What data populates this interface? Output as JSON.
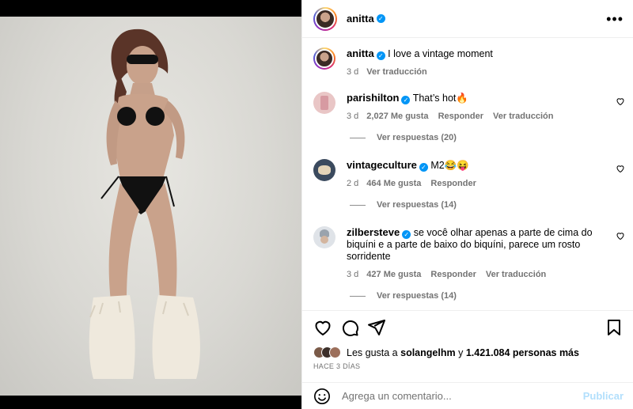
{
  "post": {
    "author": "anitta",
    "caption": "I love a vintage moment",
    "time": "3 d",
    "translate": "Ver traducción"
  },
  "comments": [
    {
      "user": "parishilton",
      "text": "That’s hot🔥",
      "time": "3 d",
      "likes": "2,027 Me gusta",
      "reply": "Responder",
      "translate": "Ver traducción",
      "replies": "Ver respuestas (20)"
    },
    {
      "user": "vintageculture",
      "text": "M2😂😝",
      "time": "2 d",
      "likes": "464 Me gusta",
      "reply": "Responder",
      "replies": "Ver respuestas (14)"
    },
    {
      "user": "zilbersteve",
      "text": "se você olhar apenas a parte de cima do biquíni e a parte de baixo do biquíni, parece um rosto sorridente",
      "time": "3 d",
      "likes": "427 Me gusta",
      "reply": "Responder",
      "translate": "Ver traducción",
      "replies": "Ver respuestas (14)"
    }
  ],
  "likes": {
    "prefix": "Les gusta a",
    "user": "solangelhm",
    "joiner": "y",
    "others": "1.421.084 personas más"
  },
  "ago": "HACE 3 DÍAS",
  "composer": {
    "placeholder": "Agrega un comentario...",
    "post_label": "Publicar"
  },
  "icons": {
    "like": "heart-icon",
    "comment": "comment-icon",
    "share": "paper-plane-icon",
    "save": "bookmark-icon",
    "emoji": "smiley-icon",
    "more": "more-horizontal-icon"
  },
  "colors": {
    "verified": "#0095f6",
    "muted": "#737373",
    "post_disabled": "#b2dffc"
  }
}
